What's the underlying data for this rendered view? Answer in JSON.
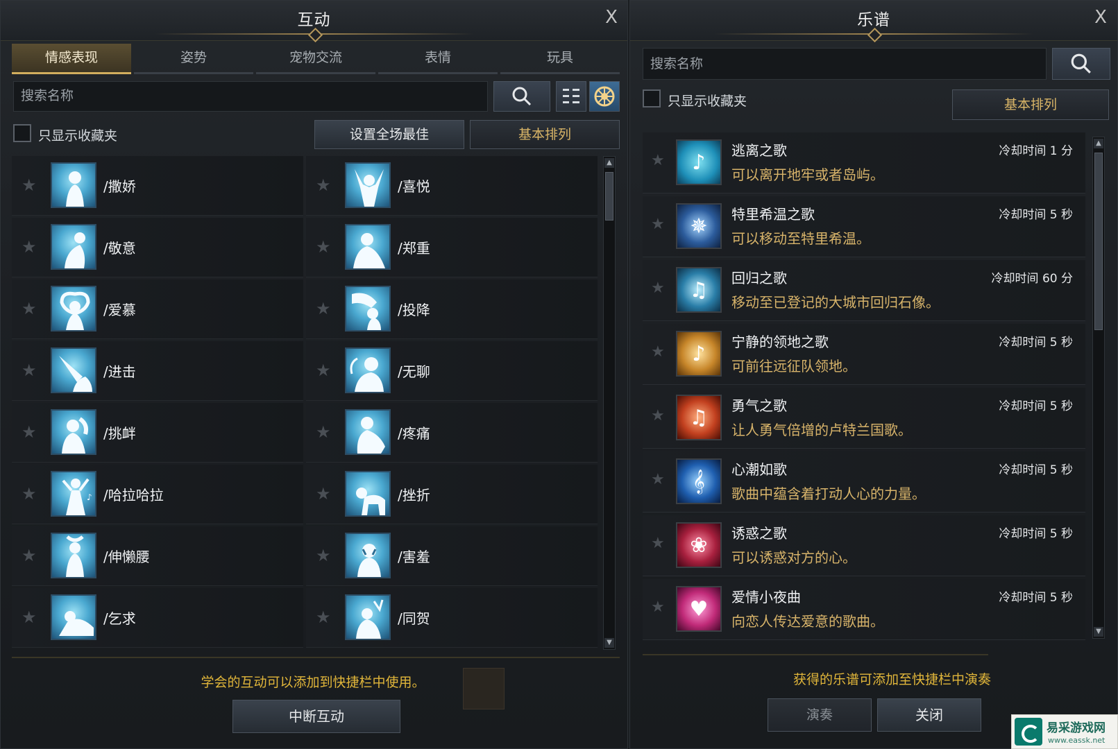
{
  "left_panel": {
    "title": "互动",
    "close_label": "X",
    "tabs": [
      "情感表现",
      "姿势",
      "宠物交流",
      "表情",
      "玩具"
    ],
    "search_placeholder": "搜索名称",
    "favorites_only_label": "只显示收藏夹",
    "set_best_button": "设置全场最佳",
    "sort_button": "基本排列",
    "emotes": [
      "/撒娇",
      "/喜悦",
      "/敬意",
      "/郑重",
      "/爱慕",
      "/投降",
      "/进击",
      "/无聊",
      "/挑衅",
      "/疼痛",
      "/哈拉哈拉",
      "/挫折",
      "/伸懒腰",
      "/害羞",
      "/乞求",
      "/同贺"
    ],
    "footer_note": "学会的互动可以添加到快捷栏中使用。",
    "stop_button": "中断互动"
  },
  "right_panel": {
    "title": "乐谱",
    "close_label": "X",
    "search_placeholder": "搜索名称",
    "favorites_only_label": "只显示收藏夹",
    "sort_button": "基本排列",
    "songs": [
      {
        "title": "逃离之歌",
        "desc": "可以离开地牢或者岛屿。",
        "cooldown": "冷却时间 1 分",
        "icon": "running-icon",
        "color": "#1e8fb8"
      },
      {
        "title": "特里希温之歌",
        "desc": "可以移动至特里希温。",
        "cooldown": "冷却时间 5 秒",
        "icon": "magic-circle-icon",
        "color": "#2c5c9c"
      },
      {
        "title": "回归之歌",
        "desc": "移动至已登记的大城市回归石像。",
        "cooldown": "冷却时间 60 分",
        "icon": "return-stone-icon",
        "color": "#2a7ea8"
      },
      {
        "title": "宁静的领地之歌",
        "desc": "可前往远征队领地。",
        "cooldown": "冷却时间 5 秒",
        "icon": "wheat-icon",
        "color": "#c7862a"
      },
      {
        "title": "勇气之歌",
        "desc": "让人勇气倍增的卢特兰国歌。",
        "cooldown": "冷却时间 5 秒",
        "icon": "sword-note-icon",
        "color": "#c2401f"
      },
      {
        "title": "心潮如歌",
        "desc": "歌曲中蕴含着打动人心的力量。",
        "cooldown": "冷却时间 5 秒",
        "icon": "treble-clef-icon",
        "color": "#1f5fb0"
      },
      {
        "title": "诱惑之歌",
        "desc": "可以诱惑对方的心。",
        "cooldown": "冷却时间 5 秒",
        "icon": "rose-icon",
        "color": "#a8203e"
      },
      {
        "title": "爱情小夜曲",
        "desc": "向恋人传达爱意的歌曲。",
        "cooldown": "冷却时间 5 秒",
        "icon": "lovers-icon",
        "color": "#c02a78"
      }
    ],
    "footer_note": "获得的乐谱可添加至快捷栏中演奏",
    "play_button": "演奏",
    "close_button": "关闭"
  },
  "watermark": {
    "name": "易采游戏网",
    "url": "www.eassk.net"
  }
}
